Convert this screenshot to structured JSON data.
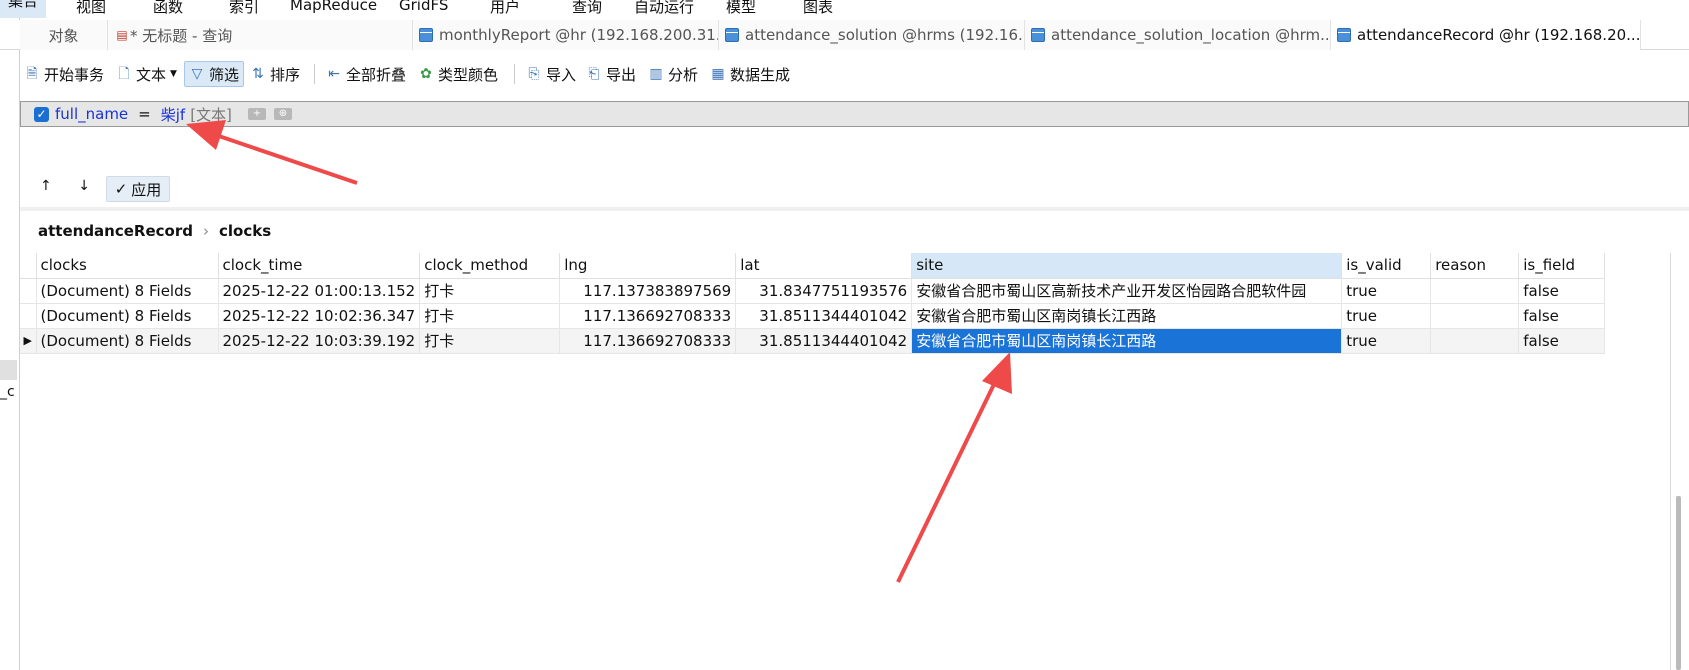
{
  "top_menu": [
    "集合",
    "视图",
    "函数",
    "索引",
    "MapReduce",
    "GridFS",
    "用户",
    "查询",
    "自动运行",
    "模型",
    "图表"
  ],
  "tabs": [
    {
      "label": "对象",
      "icon": "none"
    },
    {
      "label": "* 无标题 - 查询",
      "icon": "query-icon"
    },
    {
      "label": "monthlyReport @hr (192.168.200.31...",
      "icon": "collection-icon"
    },
    {
      "label": "attendance_solution @hrms (192.16...",
      "icon": "collection-icon"
    },
    {
      "label": "attendance_solution_location @hrm...",
      "icon": "collection-icon"
    },
    {
      "label": "attendanceRecord @hr (192.168.20...",
      "icon": "collection-icon"
    }
  ],
  "toolbar": {
    "begin_transaction": "开始事务",
    "text": "文本",
    "filter": "筛选",
    "sort": "排序",
    "collapse_all": "全部折叠",
    "type_color": "类型颜色",
    "import": "导入",
    "export": "导出",
    "analyze": "分析",
    "generate_data": "数据生成"
  },
  "filter": {
    "field": "full_name",
    "operator": "=",
    "value": "柴jf",
    "type": "[文本]"
  },
  "apply_label": "应用",
  "arrow_up": "↑",
  "arrow_down": "↓",
  "breadcrumb": {
    "root": "attendanceRecord",
    "child": "clocks"
  },
  "left_clip_text": "_c",
  "columns": [
    "clocks",
    "clock_time",
    "clock_method",
    "lng",
    "lat",
    "site",
    "is_valid",
    "reason",
    "is_field"
  ],
  "rows": [
    {
      "clocks": "(Document) 8 Fields",
      "clock_time": "2025-12-22 01:00:13.152",
      "clock_method": "打卡",
      "lng": "117.137383897569",
      "lat": "31.8347751193576",
      "site": "安徽省合肥市蜀山区高新技术产业开发区怡园路合肥软件园",
      "is_valid": "true",
      "reason": "",
      "is_field": "false"
    },
    {
      "clocks": "(Document) 8 Fields",
      "clock_time": "2025-12-22 10:02:36.347",
      "clock_method": "打卡",
      "lng": "117.136692708333",
      "lat": "31.8511344401042",
      "site": "安徽省合肥市蜀山区南岗镇长江西路",
      "is_valid": "true",
      "reason": "",
      "is_field": "false"
    },
    {
      "clocks": "(Document) 8 Fields",
      "clock_time": "2025-12-22 10:03:39.192",
      "clock_method": "打卡",
      "lng": "117.136692708333",
      "lat": "31.8511344401042",
      "site": "安徽省合肥市蜀山区南岗镇长江西路",
      "is_valid": "true",
      "reason": "",
      "is_field": "false"
    }
  ],
  "colors": {
    "annotation_arrow": "#ef4a4a",
    "selection": "#1a73d6",
    "filter_value": "#1a33d6"
  }
}
